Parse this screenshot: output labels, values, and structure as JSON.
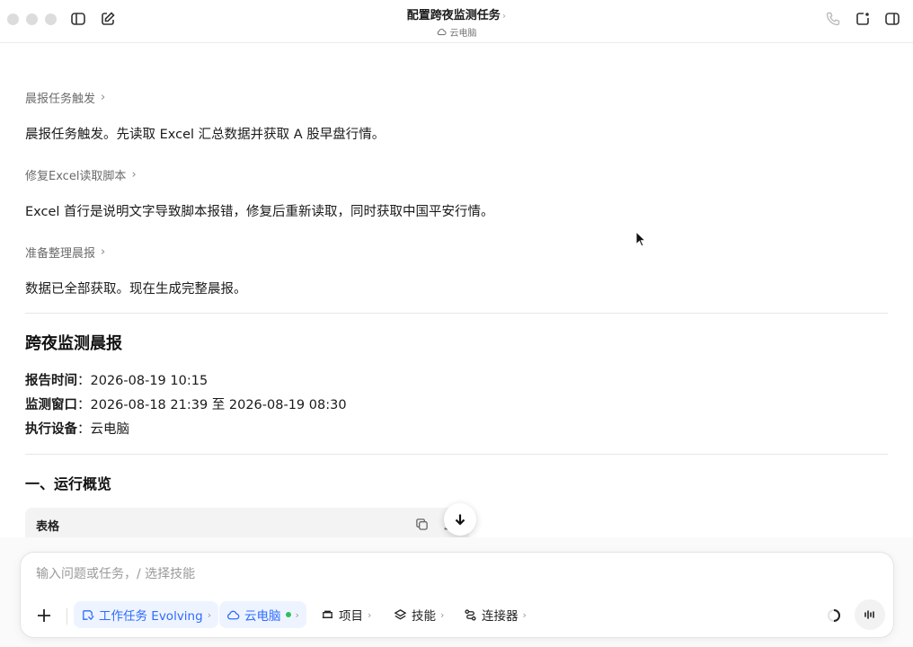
{
  "window": {
    "title": "配置跨夜监测任务",
    "title_chevron": "›",
    "subtitle": "云电脑"
  },
  "steps": [
    {
      "link": "晨报任务触发",
      "text": "晨报任务触发。先读取 Excel 汇总数据并获取 A 股早盘行情。"
    },
    {
      "link": "修复Excel读取脚本",
      "text": "Excel 首行是说明文字导致脚本报错，修复后重新读取，同时获取中国平安行情。"
    },
    {
      "link": "准备整理晨报",
      "text": "数据已全部获取。现在生成完整晨报。"
    }
  ],
  "report": {
    "title": "跨夜监测晨报",
    "time_label": "报告时间",
    "time_value": "2026-08-19 10:15",
    "window_label": "监测窗口",
    "window_value": "2026-08-18 21:39 至 2026-08-19 08:30",
    "device_label": "执行设备",
    "device_value": "云电脑",
    "section1_title": "一、运行概览",
    "table_label": "表格"
  },
  "composer": {
    "placeholder": "输入问题或任务，/ 选择技能",
    "chips": {
      "task": "工作任务 Evolving",
      "cloud": "云电脑",
      "project": "项目",
      "skills": "技能",
      "connectors": "连接器"
    }
  },
  "colors": {
    "accent": "#2f6bff",
    "online": "#2fbf5a"
  }
}
